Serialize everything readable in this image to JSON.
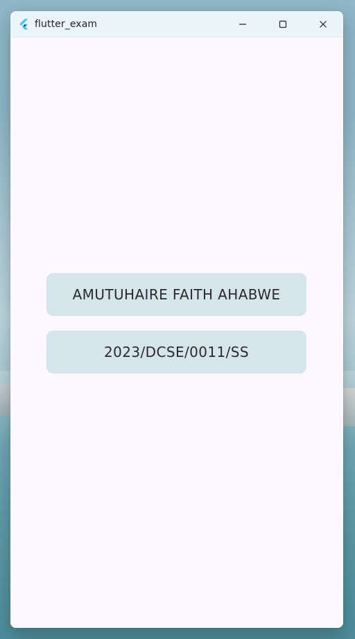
{
  "window": {
    "title": "flutter_exam"
  },
  "icons": {
    "app_icon": "flutter-logo-icon",
    "minimize_icon": "minimize-icon",
    "maximize_icon": "maximize-icon",
    "close_icon": "close-icon"
  },
  "content": {
    "name": "AMUTUHAIRE FAITH AHABWE",
    "student_id": "2023/DCSE/0011/SS"
  },
  "colors": {
    "titlebar": "#eaf4f9",
    "window_background": "#fdf7ff",
    "card_background": "#d6e4eb",
    "flutter_blue_dark": "#02569b",
    "flutter_blue_light": "#47c5fb"
  }
}
